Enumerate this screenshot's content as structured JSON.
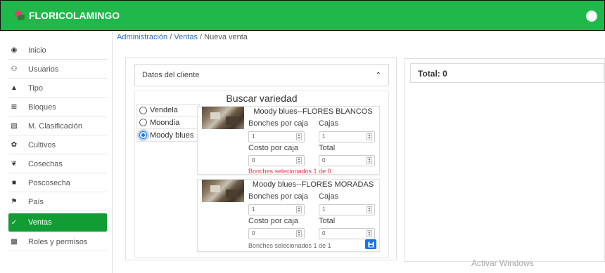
{
  "app": {
    "title": "FLORICOLAMINGO"
  },
  "breadcrumb": {
    "root": "Administración",
    "section": "Ventas",
    "current": "Nueva venta",
    "separator": "/"
  },
  "sidebar": {
    "items": [
      {
        "label": "Inicio",
        "icon": "dashboard-icon"
      },
      {
        "label": "Usuarios",
        "icon": "users-icon"
      },
      {
        "label": "Tipo",
        "icon": "flask-icon"
      },
      {
        "label": "Bloques",
        "icon": "grid-icon"
      },
      {
        "label": "M. Clasificación",
        "icon": "classification-icon"
      },
      {
        "label": "Cultivos",
        "icon": "seedling-icon"
      },
      {
        "label": "Cosechas",
        "icon": "leaf-icon"
      },
      {
        "label": "Poscosecha",
        "icon": "truck-icon"
      },
      {
        "label": "País",
        "icon": "flag-icon"
      },
      {
        "label": "Ventas",
        "icon": "cart-icon",
        "active": true
      },
      {
        "label": "Roles y permisos",
        "icon": "lock-icon"
      }
    ]
  },
  "client": {
    "header": "Datos del cliente"
  },
  "search": {
    "title": "Buscar variedad",
    "options": [
      {
        "label": "Vendela",
        "checked": false
      },
      {
        "label": "Moondia",
        "checked": false
      },
      {
        "label": "Moody blues",
        "checked": true
      }
    ]
  },
  "varieties": [
    {
      "title": "Moody blues--FLORES BLANCOS",
      "bonches_label": "Bonches por caja",
      "bonches_value": "1",
      "cajas_label": "Cajas",
      "cajas_value": "1",
      "costo_label": "Costo por caja",
      "costo_value": "0",
      "total_label": "Total",
      "total_value": "0",
      "status": "Bonches selecionados 1 de 0",
      "status_color": "#e53950"
    },
    {
      "title": "Moody blues--FLORES MORADAS",
      "bonches_label": "Bonches por caja",
      "bonches_value": "1",
      "cajas_label": "Cajas",
      "cajas_value": "1",
      "costo_label": "Costo por caja",
      "costo_value": "0",
      "total_label": "Total",
      "total_value": "0",
      "status": "Bonches selecionados 1 de 1",
      "status_color": "#666666"
    }
  ],
  "summary": {
    "total": "Total: 0"
  },
  "watermark": "Activar Windows",
  "colors": {
    "brand": "#1fb84a",
    "active_nav": "#119c34",
    "link": "#2a6fb8",
    "accent": "#1a73e8"
  }
}
